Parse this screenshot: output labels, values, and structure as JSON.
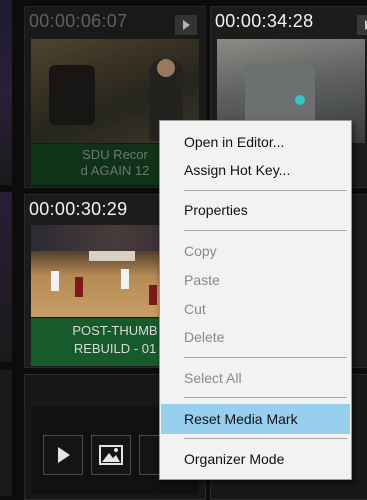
{
  "tiles": [
    {
      "timecode": "00:00:06:07",
      "caption_line1": "SDU Recor",
      "caption_line2": "d AGAIN 12"
    },
    {
      "timecode": "00:00:34:28"
    },
    {
      "timecode": "00:00:30:29",
      "caption_line1": "POST-THUMB",
      "caption_line2": "REBUILD - 01"
    }
  ],
  "context_menu": {
    "items": [
      {
        "label": "Open in Editor...",
        "enabled": true
      },
      {
        "label": "Assign Hot Key...",
        "enabled": true
      },
      {
        "label": "Properties",
        "enabled": true
      },
      {
        "label": "Copy",
        "enabled": false
      },
      {
        "label": "Paste",
        "enabled": false
      },
      {
        "label": "Cut",
        "enabled": false
      },
      {
        "label": "Delete",
        "enabled": false
      },
      {
        "label": "Select All",
        "enabled": false
      },
      {
        "label": "Reset Media Mark",
        "enabled": true,
        "highlighted": true
      },
      {
        "label": "Organizer Mode",
        "enabled": true
      }
    ]
  },
  "bottom_toolbar": {
    "icons": [
      "play-icon",
      "image-icon"
    ]
  },
  "colors": {
    "caption_green": "#175a2b",
    "menu_highlight": "#99cfee",
    "menu_background": "#f2f2f2"
  }
}
